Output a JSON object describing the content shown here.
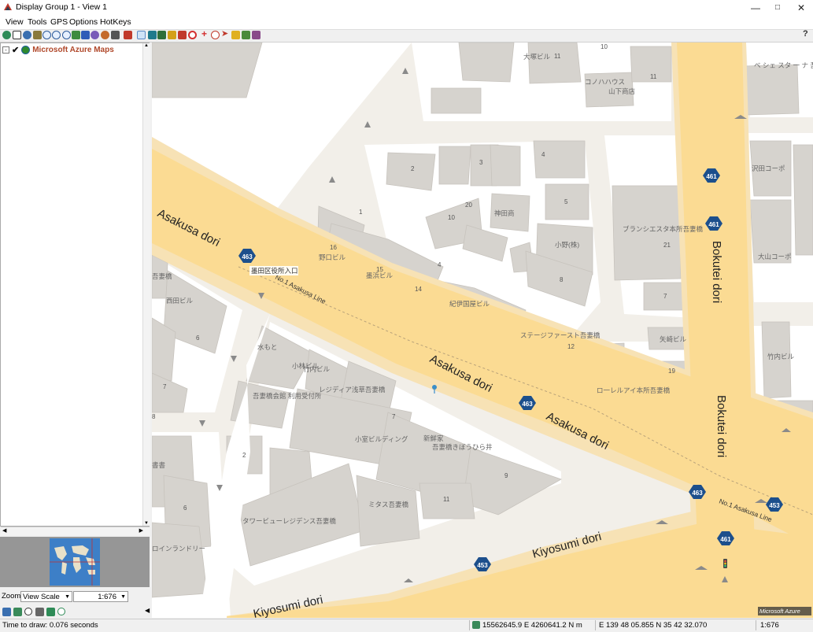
{
  "window": {
    "title": "Display Group 1 - View 1"
  },
  "menu": [
    "View",
    "Tools",
    "GPS",
    "Options",
    "HotKeys"
  ],
  "layers": [
    {
      "name": "Microsoft Azure Maps",
      "checked": true
    }
  ],
  "zoom_bar": {
    "label": "Zoom",
    "mode_value": "View Scale",
    "scale_value": "1:676"
  },
  "map": {
    "road_names": [
      "Asakusa dori",
      "Asakusa dori",
      "Asakusa dori",
      "Kiyosumi dori",
      "Kiyosumi dori",
      "Bokutei dori",
      "Bokutei dori"
    ],
    "line_labels": [
      "No.1 Asakusa Line",
      "No.1 Asakusa Line"
    ],
    "shields": [
      "463",
      "463",
      "463",
      "461",
      "461",
      "461",
      "453",
      "453"
    ],
    "poi_labels": [
      "墨田区役所入口",
      "紀伊国屋ビル",
      "ステージファースト吾妻橋",
      "レジディア浅草吾妻橋",
      "小室ビルディング",
      "吾妻橋きぼうひら井",
      "ミタス吾妻橋",
      "タワービューレジデンス吾妻橋",
      "吾妻橋会館 利用受付所",
      "ブランシエスタ本所吾妻橋",
      "ロ一レルアイ本所吾妻橋",
      "ベ シェ スタ 一 ナ 吾妻橋",
      "山下商店",
      "コノハハウス",
      "大塚ビル",
      "沢田コーポ",
      "大山コーポ",
      "竹内ビル",
      "矢崎ビル",
      "西田ビル",
      "神田商",
      "小野(株)",
      "野口ビル",
      "墨浜ビル",
      "水もと",
      "小林ビル",
      "竹内ビル",
      "新鮮家",
      "ロインランドリー",
      "吾妻橋",
      "書書"
    ],
    "numbers": [
      "11",
      "11",
      "10",
      "2",
      "3",
      "4",
      "5",
      "20",
      "10",
      "1",
      "16",
      "15",
      "4",
      "14",
      "8",
      "21",
      "7",
      "12",
      "19",
      "6",
      "7",
      "8",
      "7",
      "2",
      "9",
      "11",
      "6"
    ],
    "copyright": "Microsoft Azure"
  },
  "status": {
    "draw_time": "Time to draw: 0.076 seconds",
    "projected": "15562645.9 E 4260641.2 N m",
    "geographic": "E 139 48 05.855 N 35 42 32.070",
    "scale": "1:676"
  },
  "colors": {
    "road_major": "#fbdb93",
    "road_casing": "#f7c96a",
    "block": "#ffffff",
    "building": "#d6d3ce",
    "shield": "#1c4f8c"
  }
}
